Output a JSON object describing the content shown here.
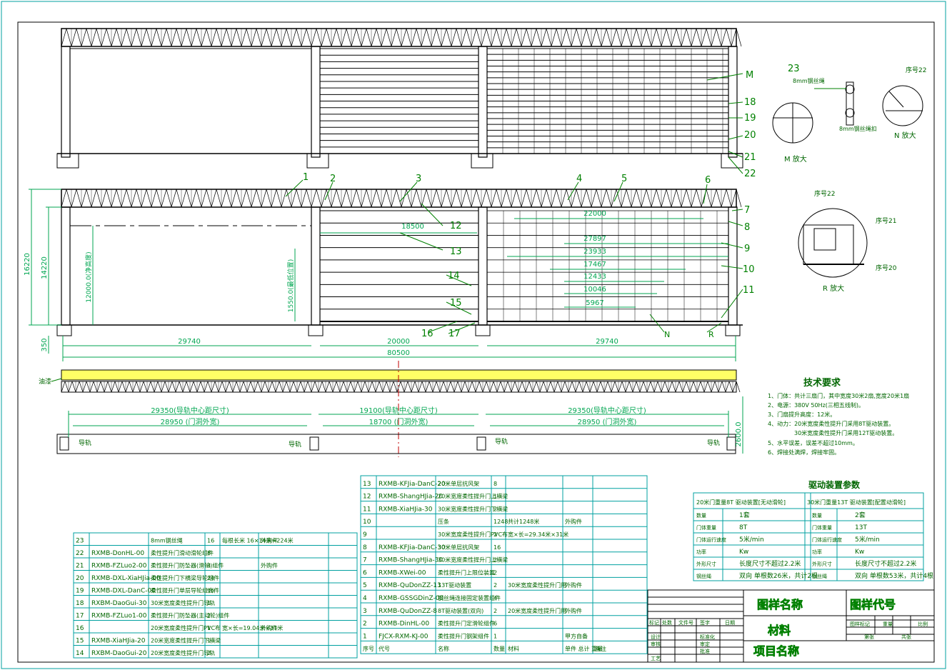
{
  "colors": {
    "frame": "#000000",
    "dim": "#00a651",
    "leader": "#00a0a0",
    "callout": "#008000",
    "highlight": "#ffff66",
    "centerline": "#c00000",
    "tableText": "#006600"
  },
  "elevations": {
    "dims": {
      "d29740a": "29740",
      "d20000": "20000",
      "d29740b": "29740",
      "d80500": "80500",
      "d16220": "16220",
      "d14220": "14220",
      "d350": "350",
      "d12000": "12000.0(净高度)",
      "d1550": "1550.0(最低位置)",
      "d18500": "18500",
      "d22000": "22000",
      "d27897": "27897",
      "d23933": "23933",
      "d17467": "17467",
      "d12433": "12433",
      "d10046": "10046",
      "d5967": "5967"
    },
    "callouts": [
      "1",
      "2",
      "3",
      "4",
      "5",
      "6",
      "7",
      "8",
      "9",
      "10",
      "11",
      "12",
      "13",
      "14",
      "15",
      "16",
      "17",
      "18",
      "19",
      "20",
      "21",
      "22"
    ],
    "labelM": "M",
    "labelN": "N",
    "labelR": "R"
  },
  "plan": {
    "leftLabel": "油漆",
    "d29350a": "29350(导轨中心距尺寸)",
    "d28950a": "28950 (门洞外宽)",
    "d19100": "19100(导轨中心距尺寸)",
    "d18700": "18700 (门洞外宽)",
    "d29350b": "29350(导轨中心距尺寸)",
    "d28950b": "28950 (门洞外宽)",
    "d2600": "2600.0",
    "rail": "导轨"
  },
  "details": {
    "m23": "23",
    "m8mm": "8mm钢丝绳",
    "m8mmClamp": "8mm钢丝绳扣",
    "mLabel": "M 放大",
    "nSeq": "序号22",
    "nLabel": "N 放大",
    "rSeq22": "序号22",
    "rSeq21": "序号21",
    "rSeq20": "序号20",
    "rLabel": "R 放大"
  },
  "tech": {
    "title": "技术要求",
    "lines": [
      "1、门体：共计三扇门，其中宽度30米2扇,宽度20米1扇",
      "2、电源：380V 50Hz(三相五线制)。",
      "3、门扇提升高度：12米。",
      "4、动力：20米宽度柔性提升门采用8T驱动装置。",
      "30米宽度柔性提升门采用12T驱动装置。",
      "5、水平误差，误差不超过10mm。",
      "6、焊接处满焊，焊接牢固。"
    ]
  },
  "drive": {
    "title": "驱动装置参数",
    "col1Head": "20米门重量8T 驱动装置[无动滑轮]",
    "col2Head": "30米门重量13T 驱动装置[配置动滑轮]",
    "rows": [
      [
        "数量",
        "1套",
        "数量",
        "2套"
      ],
      [
        "门体重量",
        "8T",
        "门体重量",
        "13T"
      ],
      [
        "门体运行速度",
        "5米/min",
        "门体运行速度",
        "5米/min"
      ],
      [
        "功率",
        "Kw",
        "功率",
        "Kw"
      ],
      [
        "外形尺寸",
        "长度尺寸不超过2.2米",
        "外形尺寸",
        "长度尺寸不超过2.2米"
      ],
      [
        "钢丝绳",
        "双向 单根数26米，共计2根",
        "钢丝绳",
        "双向 单根数53米，共计4根"
      ]
    ]
  },
  "bom1": {
    "rows": [
      [
        "23",
        "",
        "8mm钢丝绳",
        "16",
        "每根长米 16×14米=224米",
        "外购件"
      ],
      [
        "22",
        "RXMB-DonHL-00",
        "柔性提升门滑动滑轮组件",
        "8",
        "",
        ""
      ],
      [
        "21",
        "RXMB-FZLuo2-00",
        "柔性提升门防坠器(滑轮)组件",
        "4",
        "",
        "外购件"
      ],
      [
        "20",
        "RXMB-DXL-XiaHJia-00",
        "柔性提升门下横梁导轮组件",
        "24",
        "",
        ""
      ],
      [
        "19",
        "RXMB-DXL-DanC-00",
        "柔性提升门单层导轮组合件",
        "96",
        "",
        ""
      ],
      [
        "18",
        "RXBM-DaoGui-30",
        "30米宽度柔性提升门导轨",
        "1",
        "",
        ""
      ],
      [
        "17",
        "RXMB-FZLuo1-00",
        "柔性提升门防坠器(主动轮)组件",
        "2",
        "",
        ""
      ],
      [
        "16",
        "",
        "20米宽度柔性提升门PVC布",
        "1",
        "宽×长=19.04米×31米",
        "外购件"
      ],
      [
        "15",
        "RXMB-XiaHJia-20",
        "20米宽度柔性提升门下横梁",
        "1",
        "",
        ""
      ],
      [
        "14",
        "RXBM-DaoGui-20",
        "20米宽度柔性提升门导轨",
        "2",
        "",
        ""
      ]
    ]
  },
  "bom2": {
    "rows": [
      [
        "13",
        "RXMB-KFJia-DanC-20",
        "20米单层抗风架",
        "8",
        "",
        ""
      ],
      [
        "12",
        "RXMB-ShangHJia-20",
        "20米宽度柔性提升门上横梁",
        "1",
        "",
        ""
      ],
      [
        "11",
        "RXMB-XiaHJia-30",
        "30米宽度柔性提升门下横梁",
        "2",
        "",
        ""
      ],
      [
        "10",
        "",
        "压条",
        "1248",
        "共计1248米",
        "外购件"
      ],
      [
        "9",
        "",
        "30米宽度柔性提升门PVC布",
        "2",
        "宽×长=29.34米×31米",
        ""
      ],
      [
        "8",
        "RXMB-KFJia-DanC-30",
        "30米单层抗风架",
        "16",
        "",
        ""
      ],
      [
        "7",
        "RXMB-ShangHJia-30",
        "30米宽度柔性提升门上横梁",
        "2",
        "",
        ""
      ],
      [
        "6",
        "RXMB-XWei-00",
        "柔性提升门上限位装置",
        "2",
        "",
        ""
      ],
      [
        "5",
        "RXMB-QuDonZZ-13",
        "13T驱动装置",
        "2",
        "30米宽度柔性提升门用",
        "外购件"
      ],
      [
        "4",
        "RXMB-GSSGDinZ-00",
        "钢丝绳连接固定装置组件",
        "4",
        "",
        ""
      ],
      [
        "3",
        "RXMB-QuDonZZ-8",
        "8T驱动装置(双向)",
        "2",
        "20米宽度柔性提升门用",
        "外购件"
      ],
      [
        "2",
        "RXMB-DinHL-00",
        "柔性提升门定滑轮组件",
        "6",
        "",
        ""
      ],
      [
        "1",
        "FJCX-RXM-KJ-00",
        "柔性提升门钢架组件",
        "1",
        "",
        "甲方自备"
      ]
    ],
    "header": [
      "序号",
      "代号",
      "名称",
      "数量",
      "材料",
      "单件 总计 重量",
      "备注"
    ]
  },
  "title": {
    "drawingName": "图样名称",
    "drawingCode": "图样代号",
    "material": "材料",
    "project": "项目名称",
    "stage": "图样标记",
    "weight": "重量",
    "ratio": "比例",
    "sheets": "共张",
    "sheetOf": "第张",
    "left": [
      "标记",
      "处数",
      "文件号",
      "签字",
      "日期"
    ],
    "roles": [
      "设计",
      "审核",
      "工艺"
    ],
    "roles2": [
      "标准化",
      "审定",
      "批准"
    ]
  }
}
